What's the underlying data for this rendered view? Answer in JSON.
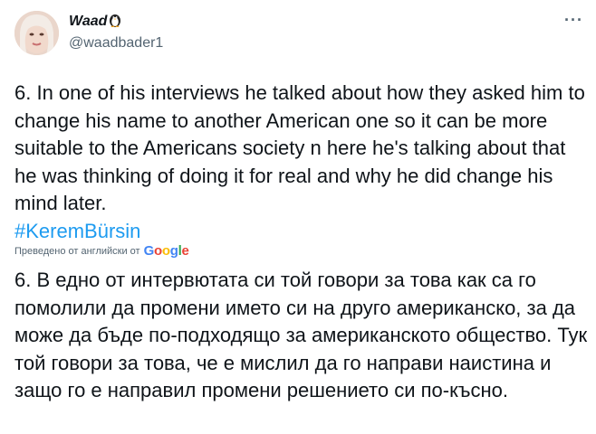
{
  "user": {
    "display_name": "Waad",
    "handle": "@waadbader1",
    "emoji_icon": "penguin-icon"
  },
  "tweet": {
    "text": "6. In one of his interviews he talked about how they asked him to change his name to another American one so it can be more suitable to the Americans society n here he's talking about that he was thinking of doing it for real and why he did change his mind later.",
    "hashtag": "#KeremBürsin"
  },
  "translation": {
    "label": "Преведено от английски от",
    "provider": "Google",
    "text": "6. В едно от интервютата си той говори за това как са го помолили да промени името си на друго американско, за да може да бъде по-подходящо за американското общество. Тук той говори за това, че е мислил да го направи наистина и защо го е направил промени решението си по-късно."
  },
  "more_label": "···",
  "colors": {
    "link": "#1d9bf0",
    "secondary_text": "#536471",
    "primary_text": "#0f1419"
  }
}
